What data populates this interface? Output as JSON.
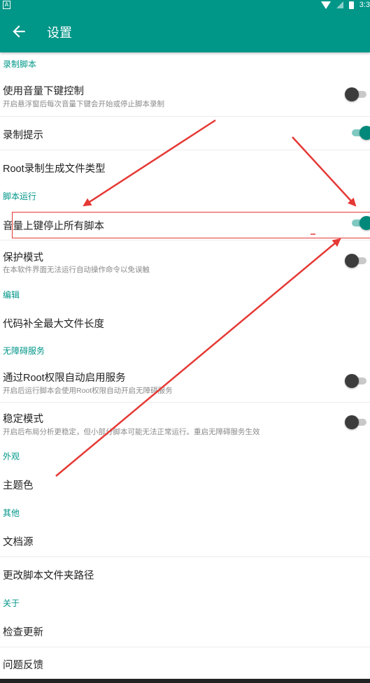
{
  "status_bar": {
    "time": "3:3",
    "notification_glyph": "A"
  },
  "app_bar": {
    "title": "设置",
    "back_icon": "arrow-left-icon"
  },
  "sections": {
    "record": {
      "header": "录制脚本",
      "volume_down": {
        "title": "使用音量下键控制",
        "summary": "开启悬浮窗后每次音量下键会开始或停止脚本录制",
        "checked": false
      },
      "record_hint": {
        "title": "录制提示",
        "checked": true
      },
      "root_type": {
        "title": "Root录制生成文件类型"
      }
    },
    "run": {
      "header": "脚本运行",
      "volume_up_stop": {
        "title": "音量上键停止所有脚本",
        "checked": true
      },
      "protect": {
        "title": "保护模式",
        "summary": "在本软件界面无法运行自动操作命令以免误触",
        "checked": false
      }
    },
    "edit": {
      "header": "编辑",
      "completion": {
        "title": "代码补全最大文件长度"
      }
    },
    "accessibility": {
      "header": "无障碍服务",
      "root_enable": {
        "title": "通过Root权限自动启用服务",
        "summary": "开启后运行脚本会使用Root权限自动开启无障碍服务",
        "checked": false
      },
      "stable": {
        "title": "稳定模式",
        "summary": "开启后布局分析更稳定，但小部分脚本可能无法正常运行。重启无障碍服务生效",
        "checked": false
      }
    },
    "appearance": {
      "header": "外观",
      "theme": {
        "title": "主题色"
      }
    },
    "other": {
      "header": "其他",
      "docs": {
        "title": "文档源"
      },
      "folder": {
        "title": "更改脚本文件夹路径"
      }
    },
    "about": {
      "header": "关于",
      "update": {
        "title": "检查更新"
      },
      "feedback": {
        "title": "问题反馈"
      }
    }
  },
  "colors": {
    "primary": "#009688",
    "accent": "#00897b",
    "annotation": "#e53935"
  }
}
